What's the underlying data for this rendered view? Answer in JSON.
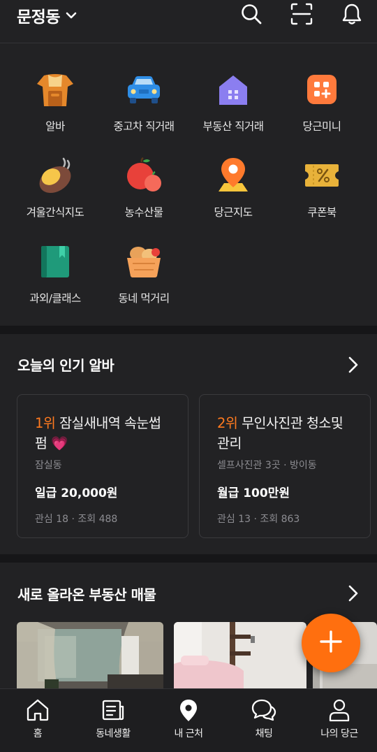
{
  "header": {
    "location": "문정동",
    "icons": [
      "chevron-down-icon",
      "search-icon",
      "scan-icon",
      "bell-icon"
    ]
  },
  "categories": [
    {
      "label": "알바",
      "icon": "apron-icon"
    },
    {
      "label": "중고차 직거래",
      "icon": "car-icon"
    },
    {
      "label": "부동산 직거래",
      "icon": "house-icon"
    },
    {
      "label": "당근미니",
      "icon": "mini-app-icon"
    },
    {
      "label": "겨울간식지도",
      "icon": "sweet-potato-icon"
    },
    {
      "label": "농수산물",
      "icon": "apple-icon"
    },
    {
      "label": "당근지도",
      "icon": "map-pin-icon"
    },
    {
      "label": "쿠폰북",
      "icon": "coupon-icon"
    },
    {
      "label": "과외/클래스",
      "icon": "book-icon"
    },
    {
      "label": "동네 먹거리",
      "icon": "bread-basket-icon"
    }
  ],
  "jobs": {
    "title": "오늘의 인기 알바",
    "cards": [
      {
        "rank": "1위",
        "title": "잠실새내역 속눈썹펌 💗",
        "location": "잠실동",
        "wage": "일급 20,000원",
        "stats": "관심 18 · 조회 488"
      },
      {
        "rank": "2위",
        "title": "무인사진관 청소및 관리",
        "location": "셀프사진관 3곳 · 방이동",
        "wage": "월급 100만원",
        "stats": "관심 13 · 조회 863"
      }
    ]
  },
  "realestate": {
    "title": "새로 올라온 부동산 매물"
  },
  "nav": {
    "items": [
      {
        "label": "홈",
        "icon": "home-icon"
      },
      {
        "label": "동네생활",
        "icon": "community-icon"
      },
      {
        "label": "내 근처",
        "icon": "location-icon"
      },
      {
        "label": "채팅",
        "icon": "chat-icon"
      },
      {
        "label": "나의 당근",
        "icon": "user-icon"
      }
    ]
  },
  "colors": {
    "background": "#222224",
    "accent": "#ff6f0f",
    "rank": "#ff7a1f"
  }
}
